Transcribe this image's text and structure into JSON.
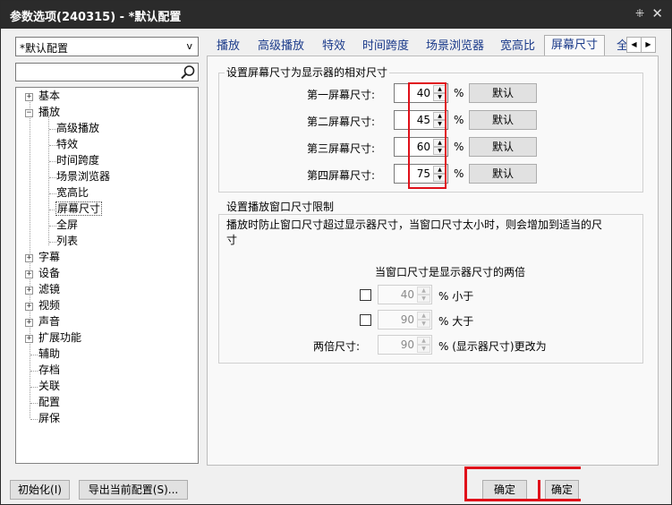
{
  "window": {
    "title": "参数选项(240315) - *默认配置",
    "pin_glyph": "⁜",
    "close_glyph": "✕"
  },
  "profile": {
    "value": "*默认配置",
    "arrow": "v"
  },
  "search": {
    "value": "",
    "placeholder": ""
  },
  "tree": {
    "items": [
      {
        "label": "基本",
        "toggle": "+"
      },
      {
        "label": "播放",
        "toggle": "−"
      },
      {
        "label": "高级播放"
      },
      {
        "label": "特效"
      },
      {
        "label": "时间跨度"
      },
      {
        "label": "场景浏览器"
      },
      {
        "label": "宽高比"
      },
      {
        "label": "屏幕尺寸"
      },
      {
        "label": "全屏"
      },
      {
        "label": "列表"
      },
      {
        "label": "字幕",
        "toggle": "+"
      },
      {
        "label": "设备",
        "toggle": "+"
      },
      {
        "label": "滤镜",
        "toggle": "+"
      },
      {
        "label": "视频",
        "toggle": "+"
      },
      {
        "label": "声音",
        "toggle": "+"
      },
      {
        "label": "扩展功能",
        "toggle": "+"
      },
      {
        "label": "辅助"
      },
      {
        "label": "存档"
      },
      {
        "label": "关联"
      },
      {
        "label": "配置"
      },
      {
        "label": "屏保"
      }
    ]
  },
  "tabs": [
    "播放",
    "高级播放",
    "特效",
    "时间跨度",
    "场景浏览器",
    "宽高比",
    "屏幕尺寸",
    "全"
  ],
  "tab_scroll": {
    "left": "◀",
    "right": "▶"
  },
  "screen_size": {
    "title": "设置屏幕尺寸为显示器的相对尺寸",
    "rows": [
      {
        "label": "第一屏幕尺寸:",
        "value": "40",
        "unit": "%",
        "button": "默认"
      },
      {
        "label": "第二屏幕尺寸:",
        "value": "45",
        "unit": "%",
        "button": "默认"
      },
      {
        "label": "第三屏幕尺寸:",
        "value": "60",
        "unit": "%",
        "button": "默认"
      },
      {
        "label": "第四屏幕尺寸:",
        "value": "75",
        "unit": "%",
        "button": "默认"
      }
    ]
  },
  "window_limit": {
    "title": "设置播放窗口尺寸限制",
    "description_line1": "播放时防止窗口尺寸超过显示器尺寸，当窗口尺寸太小时，则会增加到适当的尺",
    "description_line2": "寸",
    "double_heading": "当窗口尺寸是显示器尺寸的两倍",
    "less": {
      "value": "40",
      "label": "% 小于"
    },
    "greater": {
      "value": "90",
      "label": "% 大于"
    },
    "double": {
      "label": "两倍尺寸:",
      "value": "90",
      "suffix": "% (显示器尺寸)更改为"
    }
  },
  "spin_arrows": {
    "up": "▲",
    "down": "▼"
  },
  "search_icon": "⌕",
  "bottom": {
    "init": "初始化(I)",
    "export": "导出当前配置(S)...",
    "ok_cancel": "确定",
    "ok": "确定"
  },
  "colors": {
    "titlebar": "#2b2b2b",
    "highlight": "#e0101a",
    "tab_text": "#1a3a8a"
  }
}
